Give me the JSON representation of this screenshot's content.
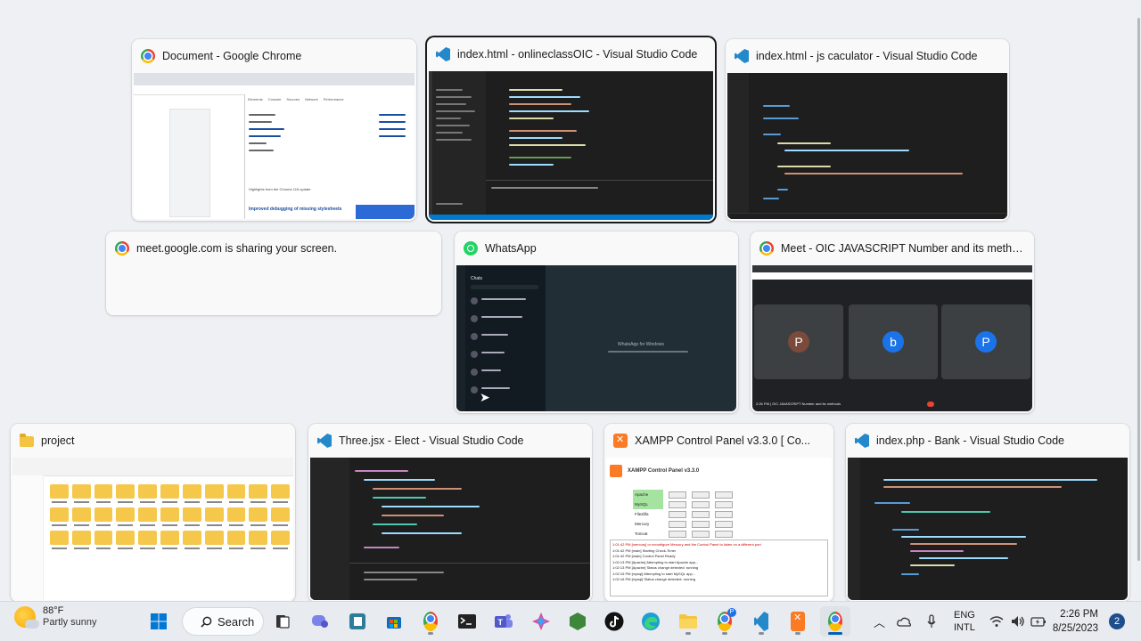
{
  "windows": [
    {
      "id": "chrome-doc",
      "title": "Document - Google Chrome",
      "icon": "chrome-icon",
      "selected": false
    },
    {
      "id": "vscode-onlineclass",
      "title": "index.html - onlineclassOIC - Visual Studio Code",
      "icon": "vscode-icon",
      "selected": true
    },
    {
      "id": "vscode-jscalc",
      "title": "index.html - js caculator - Visual Studio Code",
      "icon": "vscode-icon",
      "selected": false
    },
    {
      "id": "meet-sharing",
      "title": "meet.google.com is sharing your screen.",
      "icon": "chrome-icon",
      "selected": false
    },
    {
      "id": "whatsapp",
      "title": "WhatsApp",
      "icon": "whatsapp-icon",
      "selected": false
    },
    {
      "id": "meet-oic",
      "title": "Meet - OIC JAVASCRIPT Number and its metho...",
      "icon": "chrome-icon",
      "selected": false
    },
    {
      "id": "explorer-project",
      "title": "project",
      "icon": "folder-icon",
      "selected": false
    },
    {
      "id": "vscode-three",
      "title": "Three.jsx - Elect - Visual Studio Code",
      "icon": "vscode-icon",
      "selected": false
    },
    {
      "id": "xampp",
      "title": "XAMPP Control Panel v3.3.0   [ Co...",
      "icon": "xampp-icon",
      "selected": false
    },
    {
      "id": "vscode-bank",
      "title": "index.php - Bank - Visual Studio Code",
      "icon": "vscode-icon",
      "selected": false
    }
  ],
  "chrome_thumb": {
    "banner_text": "Improved debugging of missing stylesheets",
    "highlight_text": "Highlights from the Chrome 116 update",
    "tabs": [
      "Elements",
      "Console",
      "Sources",
      "Network",
      "Performance"
    ]
  },
  "meet_thumb": {
    "participants": [
      {
        "initial": "P",
        "color": "#7b4a3a"
      },
      {
        "initial": "b",
        "color": "#1a73e8"
      },
      {
        "initial": "P",
        "color": "#1a73e8"
      }
    ],
    "footer": "2:26 PM | OIC JAVASCRIPT Number and its methods"
  },
  "whatsapp_thumb": {
    "header": "Chats",
    "center_title": "WhatsApp for Windows"
  },
  "xampp_thumb": {
    "title": "XAMPP Control Panel v3.3.0",
    "modules": [
      "Apache",
      "MySQL",
      "FileZilla",
      "Mercury",
      "Tomcat"
    ],
    "log": [
      "1:01:42 PM  [mercury]  or reconfigure Mercury and the Control Panel to listen on a different port",
      "1:01:42 PM  [main]  Starting Check-Timer",
      "1:01:42 PM  [main]  Control Panel Ready",
      "1:02:13 PM  [Apache]  Attempting to start Apache app...",
      "1:02:13 PM  [Apache]  Status change detected: running",
      "1:02:15 PM  [mysql]  Attempting to start MySQL app...",
      "1:02:16 PM  [mysql]  Status change detected: running"
    ]
  },
  "taskbar": {
    "weather_temp": "88°F",
    "weather_cond": "Partly sunny",
    "search_label": "Search",
    "lang_top": "ENG",
    "lang_bottom": "INTL",
    "time": "2:26 PM",
    "date": "8/25/2023",
    "notifications": "2"
  }
}
